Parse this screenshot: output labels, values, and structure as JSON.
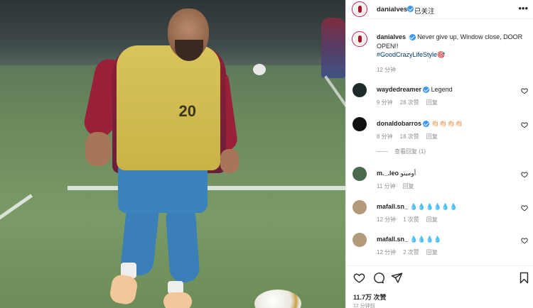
{
  "post": {
    "username": "danialves",
    "follow_label": "已关注",
    "caption_line1": "Never give up, Window close, DOOR",
    "caption_line2": "OPEN!!",
    "hashtag": "#GoodCrazyLifeStyle",
    "hashtag_suffix": "🎯",
    "caption_time": "12 分钟",
    "bib_number": "20",
    "likes": "11.7万 次赞",
    "post_time": "12 分钟前"
  },
  "comments": [
    {
      "user": "waydedreamer",
      "verified": true,
      "text": "Legend",
      "time": "9 分钟",
      "likes": "28 次赞",
      "reply": "回复",
      "avatar_color": "#1e2a2a"
    },
    {
      "user": "donaldobarros",
      "verified": true,
      "text": "👏🏻👏🏻👏🏻👏🏻",
      "time": "8 分钟",
      "likes": "18 次赞",
      "reply": "回复",
      "avatar_color": "#111111"
    },
    {
      "user": "m._.leo",
      "verified": false,
      "text": "أوميتو",
      "time": "11 分钟",
      "likes": "",
      "reply": "回复",
      "avatar_color": "#4a6a4e"
    },
    {
      "user": "mafall.sn_",
      "verified": false,
      "text": "💧💧💧💧💧💧",
      "time": "12 分钟",
      "likes": "1 次赞",
      "reply": "回复",
      "avatar_color": "#b39a7a"
    },
    {
      "user": "mafall.sn_",
      "verified": false,
      "text": "💧💧💧💧",
      "time": "12 分钟",
      "likes": "2 次赞",
      "reply": "回复",
      "avatar_color": "#b39a7a"
    }
  ],
  "view_replies": "查看回复 (1)",
  "icons": {
    "more": "more-icon",
    "like": "heart-icon",
    "comment": "comment-icon",
    "share": "share-icon",
    "save": "bookmark-icon"
  },
  "colors": {
    "verified": "#3897f0",
    "hashtag": "#00376b",
    "muted": "#8e8e8e",
    "ring": "#c2185b"
  }
}
